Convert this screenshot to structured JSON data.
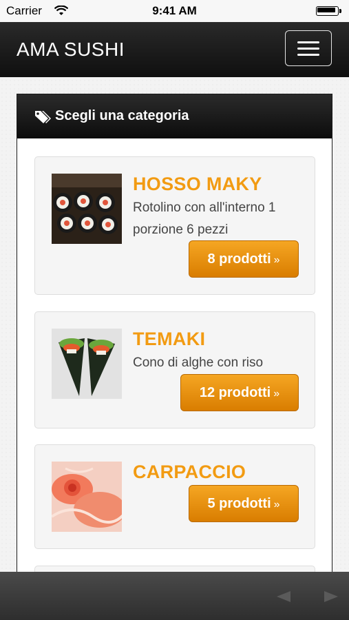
{
  "status_bar": {
    "carrier": "Carrier",
    "time": "9:41 AM"
  },
  "navbar": {
    "brand": "AMA SUSHI",
    "menu_icon": "hamburger-icon"
  },
  "panel": {
    "icon": "tags-icon",
    "title": "Scegli una categoria"
  },
  "categories": [
    {
      "title": "HOSSO MAKY",
      "description": "Rotolino con all'interno 1 porzione 6 pezzi",
      "button_label": "8 prodotti",
      "button_suffix": "»"
    },
    {
      "title": "TEMAKI",
      "description": "Cono di alghe con riso",
      "button_label": "12 prodotti",
      "button_suffix": "»"
    },
    {
      "title": "CARPACCIO",
      "description": "",
      "button_label": "5 prodotti",
      "button_suffix": "»"
    }
  ],
  "toolbar": {
    "back_icon": "back-arrow-icon",
    "forward_icon": "forward-arrow-icon"
  },
  "colors": {
    "accent": "#f29b12",
    "button": "#e98c0a",
    "nav": "#1a1a1a"
  }
}
